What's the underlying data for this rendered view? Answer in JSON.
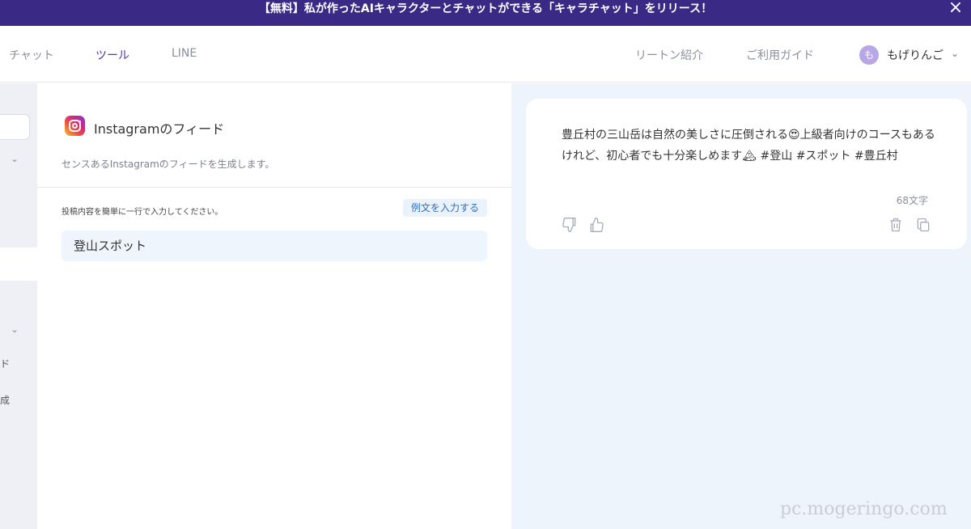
{
  "banner": {
    "text": "【無料】私が作ったAIキャラクターとチャットができる「キャラチャット」をリリース！",
    "close_label": "×"
  },
  "nav": {
    "items": [
      {
        "label": "チャット",
        "active": false
      },
      {
        "label": "ツール",
        "active": true
      },
      {
        "label": "LINE",
        "active": false
      }
    ],
    "intro_link": "リートン紹介",
    "guide_link": "ご利用ガイド",
    "avatar_letter": "も",
    "username": "もげりんご"
  },
  "left_rail": {
    "chars": [
      "ド",
      "成"
    ]
  },
  "tool": {
    "icon": "instagram-icon",
    "title": "Instagramのフィード",
    "description": "センスあるInstagramのフィードを生成します。",
    "field_label": "投稿内容を簡単に一行で入力してください。",
    "example_button": "例文を入力する",
    "field_value": "登山スポット"
  },
  "result": {
    "text": "豊丘村の三山岳は自然の美しさに圧倒される😍上級者向けのコースもあるけれど、初心者でも十分楽しめます🏔 #登山 #スポット #豊丘村",
    "char_count": "68文字"
  },
  "watermark": "pc.mogeringo.com",
  "colors": {
    "banner_bg": "#3a2a86",
    "active_tab": "#4a3ab0",
    "right_pane_bg": "#eef4fc",
    "example_button_text": "#2e6fc0"
  }
}
